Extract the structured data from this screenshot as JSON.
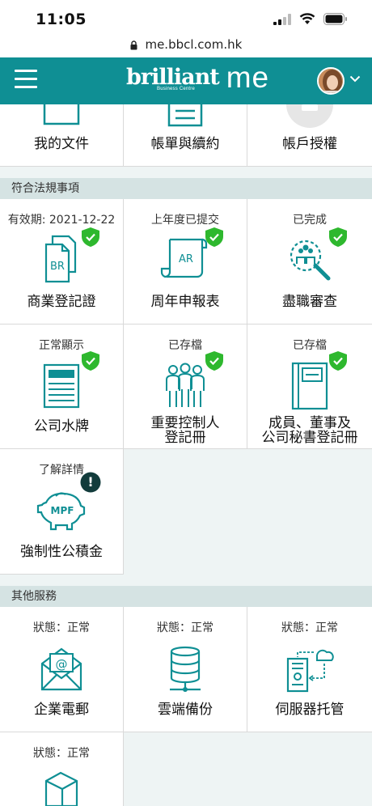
{
  "status_bar": {
    "time": "11:05"
  },
  "browser": {
    "url": "me.bbcl.com.hk"
  },
  "header": {
    "brand_main": "brilliant",
    "brand_sub": "Business Centre",
    "brand_me": "me"
  },
  "top_row": [
    {
      "label": "我的文件",
      "icon": "document-icon"
    },
    {
      "label": "帳單與續約",
      "icon": "invoice-icon"
    },
    {
      "label": "帳戶授權",
      "icon": "account-folder-icon"
    }
  ],
  "compliance": {
    "title": "符合法規事項",
    "items": [
      {
        "status": "有效期: 2021-12-22",
        "label": "商業登記證",
        "icon": "br-document-icon",
        "badge": "check"
      },
      {
        "status": "上年度已提交",
        "label": "周年申報表",
        "icon": "ar-scroll-icon",
        "badge": "check"
      },
      {
        "status": "已完成",
        "label": "盡職審查",
        "icon": "due-diligence-icon",
        "badge": "check"
      },
      {
        "status": "正常顯示",
        "label": "公司水牌",
        "icon": "signboard-icon",
        "badge": "check"
      },
      {
        "status": "已存檔",
        "label_line1": "重要控制人",
        "label_line2": "登記冊",
        "icon": "people-icon",
        "badge": "check"
      },
      {
        "status": "已存檔",
        "label_line1": "成員、董事及",
        "label_line2": "公司秘書登記冊",
        "icon": "register-book-icon",
        "badge": "check"
      },
      {
        "status": "了解詳情",
        "label": "強制性公積金",
        "icon": "mpf-piggy-icon",
        "badge": "alert",
        "badge_text": "!"
      }
    ]
  },
  "other_services": {
    "title": "其他服務",
    "items": [
      {
        "status": "狀態：正常",
        "label": "企業電郵",
        "icon": "email-icon"
      },
      {
        "status": "狀態：正常",
        "label": "雲端備份",
        "icon": "database-icon"
      },
      {
        "status": "狀態：正常",
        "label": "伺服器托管",
        "icon": "server-cloud-icon"
      },
      {
        "status": "狀態：正常",
        "label": "",
        "icon": "box-icon"
      }
    ]
  },
  "colors": {
    "teal": "#0f8f94",
    "badge_green": "#2eb82e",
    "alert": "#123c3c",
    "section_bg": "#d5e3e3",
    "empty_bg": "#eef4f4"
  }
}
